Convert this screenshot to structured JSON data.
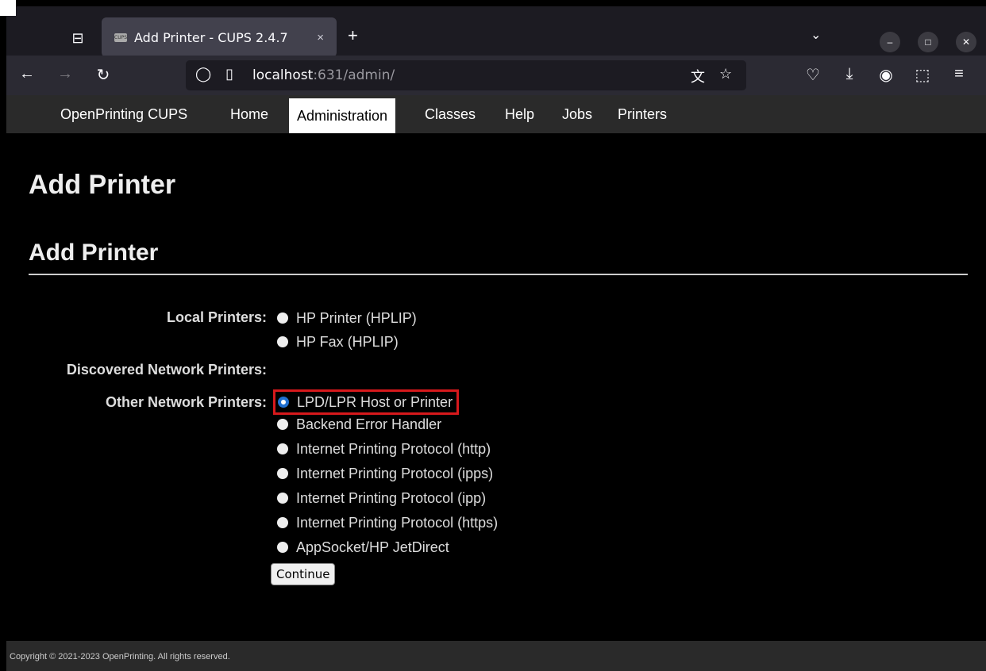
{
  "browser": {
    "tab_title": "Add Printer - CUPS 2.4.7",
    "tab_close": "×",
    "new_tab": "+",
    "url_host": "localhost",
    "url_rest": ":631/admin/",
    "favicon_text": "CUPS"
  },
  "cups_nav": {
    "brand": "OpenPrinting CUPS",
    "items": [
      "Home",
      "Administration",
      "Classes",
      "Help",
      "Jobs",
      "Printers"
    ],
    "active": "Administration"
  },
  "page": {
    "title": "Add Printer",
    "section_title": "Add Printer"
  },
  "form": {
    "local_label": "Local Printers:",
    "local_options": [
      "HP Printer (HPLIP)",
      "HP Fax (HPLIP)"
    ],
    "discovered_label": "Discovered Network Printers:",
    "other_label": "Other Network Printers:",
    "other_options": [
      "LPD/LPR Host or Printer",
      "Backend Error Handler",
      "Internet Printing Protocol (http)",
      "Internet Printing Protocol (ipps)",
      "Internet Printing Protocol (ipp)",
      "Internet Printing Protocol (https)",
      "AppSocket/HP JetDirect"
    ],
    "selected": "LPD/LPR Host or Printer",
    "continue_label": "Continue"
  },
  "footer": {
    "copyright": "Copyright © 2021-2023 OpenPrinting. All rights reserved."
  },
  "colors": {
    "highlight_box": "#d7191c",
    "radio_selected": "#1f6fd1"
  }
}
